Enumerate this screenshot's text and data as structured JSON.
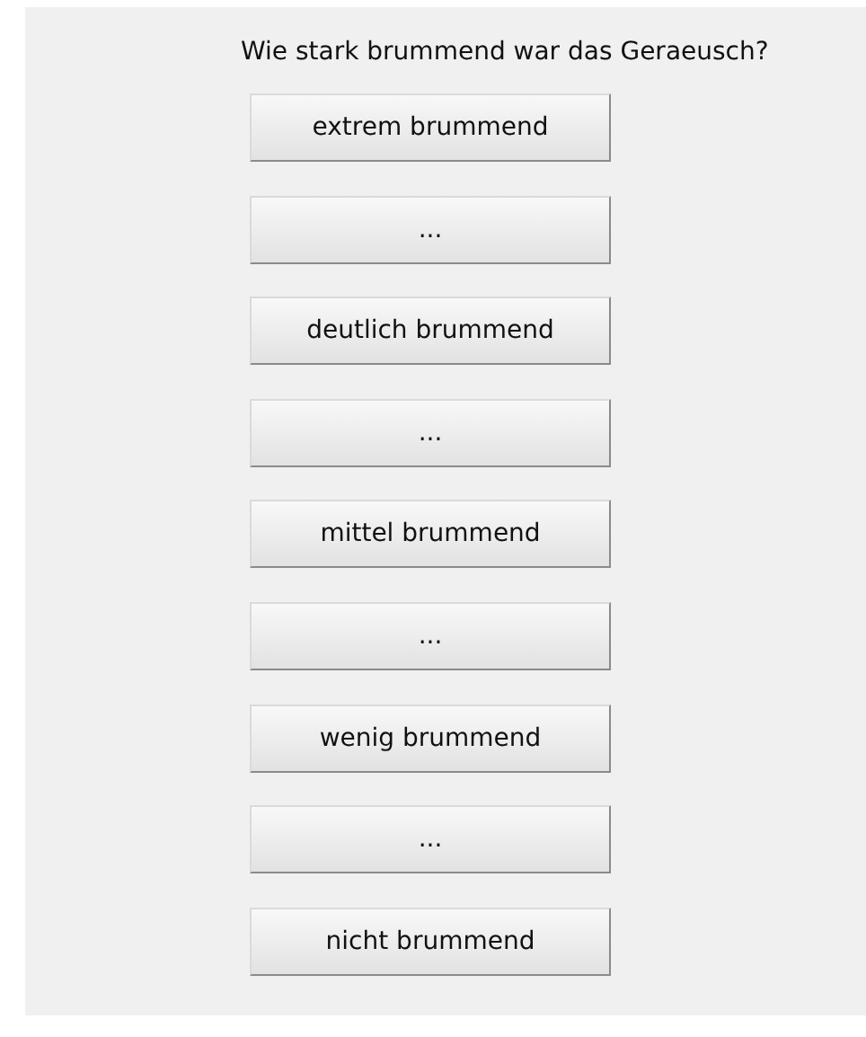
{
  "question": "Wie stark brummend war das Geraeusch?",
  "options": [
    "extrem brummend",
    "...",
    "deutlich brummend",
    "...",
    "mittel brummend",
    "...",
    "wenig brummend",
    "...",
    "nicht brummend"
  ]
}
